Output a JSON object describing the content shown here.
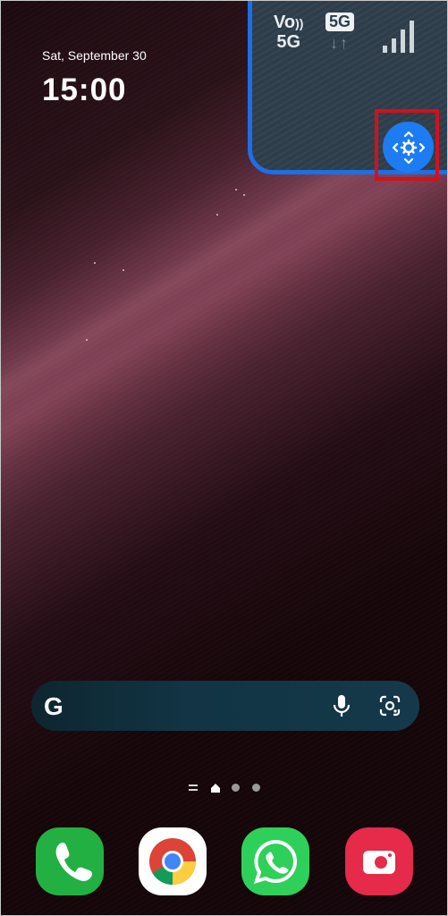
{
  "lock_screen": {
    "date": "Sat, September 30",
    "time": "15:00"
  },
  "status_bar_zoom": {
    "volte_top": "Vo",
    "volte_wave": "))",
    "volte_bottom": "5G",
    "network_badge": "5G",
    "data_arrows": "↓↑",
    "signal_icon": "signal-bars-icon",
    "border_color": "#1e6ee6"
  },
  "move_button": {
    "icon": "move-settings-icon",
    "color": "#1d7cf2",
    "highlight_color": "#d3111c"
  },
  "search_widget": {
    "logo": "G",
    "mic_icon": "microphone-icon",
    "lens_icon": "google-lens-icon"
  },
  "page_indicator": {
    "pages": 3,
    "current": 1
  },
  "dock": [
    {
      "app": "Phone",
      "icon": "phone-icon",
      "color": "#22b043"
    },
    {
      "app": "Chrome",
      "icon": "chrome-icon",
      "color": "#ffffff"
    },
    {
      "app": "WhatsApp",
      "icon": "whatsapp-icon",
      "color": "#2fd05a"
    },
    {
      "app": "Camera",
      "icon": "camera-icon",
      "color": "#e52a4a"
    }
  ]
}
